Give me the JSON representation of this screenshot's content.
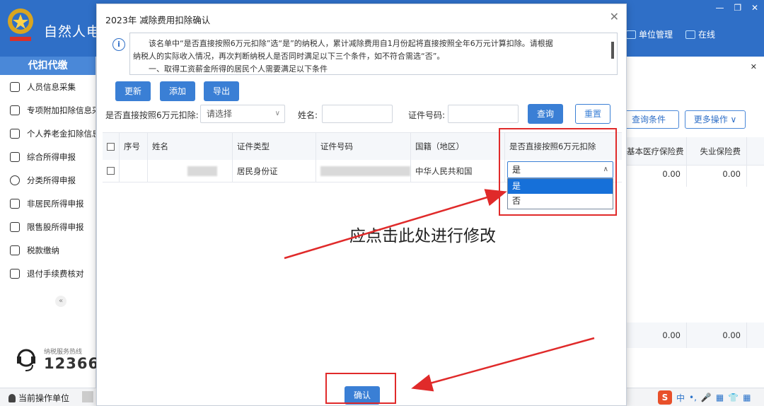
{
  "app": {
    "title": "自然人电子",
    "header_right": [
      "单位管理",
      "在线"
    ],
    "window_controls": [
      "—",
      "❐",
      "✕"
    ]
  },
  "sidebar": {
    "title": "代扣代缴",
    "items": [
      {
        "label": "人员信息采集",
        "icon": "person-icon"
      },
      {
        "label": "专项附加扣除信息采",
        "icon": "list-icon"
      },
      {
        "label": "个人养老金扣除信息",
        "icon": "document-icon"
      },
      {
        "label": "综合所得申报",
        "icon": "layers-icon"
      },
      {
        "label": "分类所得申报",
        "icon": "clock-icon"
      },
      {
        "label": "非居民所得申报",
        "icon": "user-icon"
      },
      {
        "label": "限售股所得申报",
        "icon": "bar-chart-icon"
      },
      {
        "label": "税款缴纳",
        "icon": "folder-icon"
      },
      {
        "label": "退付手续费核对",
        "icon": "file-icon"
      }
    ],
    "collapse": "«",
    "hotline_label": "纳税服务热线",
    "hotline_number": "12366"
  },
  "status_bar": {
    "unit_label": "当前操作单位",
    "ime": [
      "S",
      "中",
      "•,",
      "🎤",
      "▦",
      "👕",
      "▦"
    ]
  },
  "background_panel": {
    "close": "✕",
    "query_conditions_button": "查询条件",
    "more_actions_button": "更多操作 ∨",
    "columns": [
      "基本医疗保险费",
      "失业保险费"
    ],
    "row1": [
      "0.00",
      "0.00"
    ],
    "row2": [
      "0.00",
      "0.00"
    ]
  },
  "modal": {
    "title": "2023年 减除费用扣除确认",
    "close": "✕",
    "notice": {
      "line1": "该名单中“是否直接按照6万元扣除”选“是”的纳税人，累计减除费用自1月份起将直接按照全年6万元计算扣除。请根据",
      "line2": "纳税人的实际收入情况，再次判断纳税人是否同时满足以下三个条件，如不符合需选“否”。",
      "line3": "一、取得工资薪金所得的居民个人需要满足以下条件"
    },
    "buttons": {
      "refresh": "更新",
      "add": "添加",
      "export": "导出",
      "query": "查询",
      "reset": "重置",
      "confirm": "确认"
    },
    "filters": {
      "direct_label": "是否直接按照6万元扣除:",
      "direct_placeholder": "请选择",
      "name_label": "姓名:",
      "id_label": "证件号码:"
    },
    "table": {
      "headers": [
        "序号",
        "姓名",
        "证件类型",
        "证件号码",
        "国籍（地区）",
        "是否直接按照6万元扣除"
      ],
      "rows": [
        {
          "seq": "",
          "name": "",
          "id_type": "居民身份证",
          "id_number": "",
          "nationality": "中华人民共和国",
          "direct": "是"
        }
      ]
    },
    "dropdown": {
      "selected": "是",
      "options": [
        "是",
        "否"
      ]
    }
  },
  "annotation": {
    "text": "应点击此处进行修改",
    "color": "#e02a2a"
  }
}
